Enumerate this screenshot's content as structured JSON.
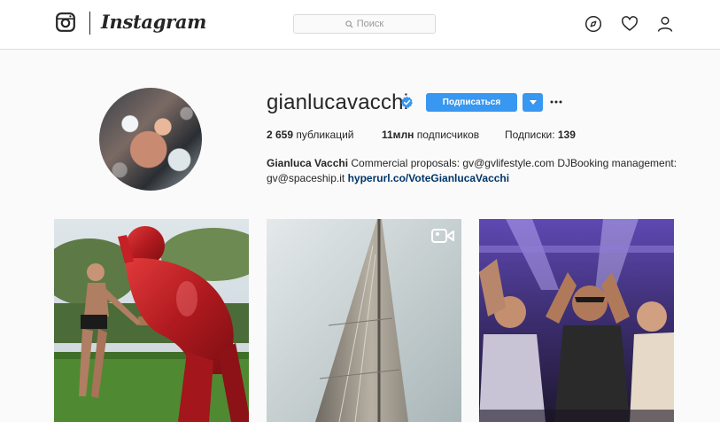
{
  "header": {
    "logo_text": "Instagram",
    "search_placeholder": "Поиск",
    "icons": [
      "instagram-glyph-icon",
      "compass-icon",
      "heart-icon",
      "person-icon"
    ]
  },
  "profile": {
    "username": "gianlucavacchi",
    "verified": true,
    "follow_label": "Подписаться",
    "stats": {
      "posts_value": "2 659",
      "posts_label": "публикаций",
      "followers_value": "11млн",
      "followers_label": "подписчиков",
      "following_label": "Подписки:",
      "following_value": "139"
    },
    "bio": {
      "name": "Gianluca Vacchi",
      "text": "Commercial proposals: gv@gvlifestyle.com DJBooking management: gv@spaceship.it",
      "link": "hyperurl.co/VoteGianlucaVacchi"
    }
  },
  "posts": [
    {
      "kind": "photo",
      "icon": "",
      "colors": [
        "#4a6b3a",
        "#b81e22"
      ]
    },
    {
      "kind": "video",
      "icon": "video-camera-icon",
      "colors": [
        "#c9d1d4",
        "#8e8a82"
      ]
    },
    {
      "kind": "photo",
      "icon": "",
      "colors": [
        "#5a3fa0",
        "#2a1f3d"
      ]
    }
  ],
  "colors": {
    "accent": "#3897f0",
    "link": "#003569",
    "border": "#dbdbdb",
    "background": "#fafafa"
  }
}
